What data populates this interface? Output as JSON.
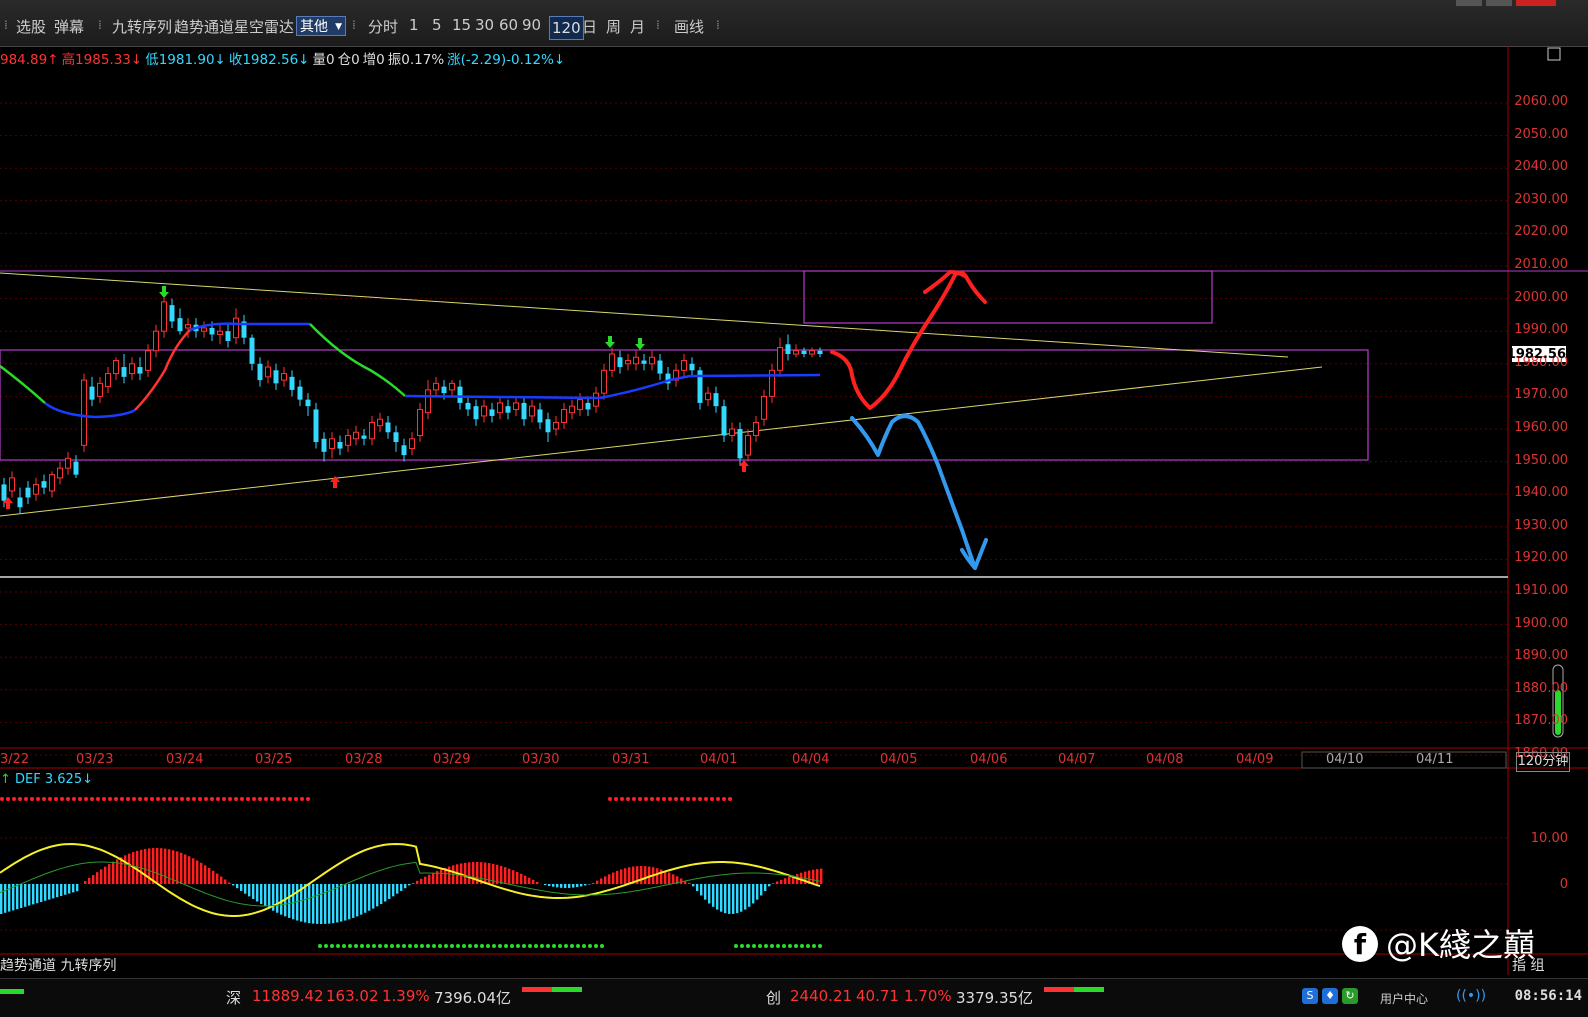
{
  "toolbar": {
    "items": [
      "选股",
      "弹幕",
      "九转序列",
      "趋势通道",
      "星空雷达"
    ],
    "dropdown_value": "其他",
    "periods": [
      "分时",
      "1",
      "5",
      "15",
      "30",
      "60",
      "90"
    ],
    "active_period": "120",
    "periods_after": [
      "日",
      "周",
      "月"
    ],
    "draw": "画线"
  },
  "info_line": {
    "open": "984.89↑",
    "high": "高1985.33↓",
    "low": "低1981.90↓",
    "close": "收1982.56↓",
    "volume": "量0",
    "position": "仓0",
    "increase": "增0",
    "amplitude": "振0.17%",
    "change": "涨(-2.29)-0.12%↓"
  },
  "price_axis": [
    "2060.00",
    "2050.00",
    "2040.00",
    "2030.00",
    "2020.00",
    "2010.00",
    "2000.00",
    "1990.00",
    "1980.00",
    "1970.00",
    "1960.00",
    "1950.00",
    "1940.00",
    "1930.00",
    "1920.00",
    "1910.00",
    "1900.00",
    "1890.00",
    "1880.00",
    "1870.00",
    "1860.00"
  ],
  "current_price": "1982.56",
  "date_axis": [
    "3/22",
    "03/23",
    "03/24",
    "03/25",
    "03/28",
    "03/29",
    "03/30",
    "03/31",
    "04/01",
    "04/04",
    "04/05",
    "04/06",
    "04/07",
    "04/08",
    "04/09",
    "04/10",
    "04/11"
  ],
  "period_label": "120分钟",
  "indicator": {
    "arrow": "↑",
    "label": "DEF 3.625↓"
  },
  "sub_axis": [
    "10.00",
    "0"
  ],
  "bottom_tabs": [
    "趋势通道",
    "九转序列"
  ],
  "status_bar": {
    "sz_label": "深",
    "sz_value": "11889.42",
    "sz_change": "163.02",
    "sz_pct": "1.39%",
    "sz_amount": "7396.04亿",
    "cy_label": "创",
    "cy_value": "2440.21",
    "cy_change": "40.71",
    "cy_pct": "1.70%",
    "cy_amount": "3379.35亿",
    "user_center": "用户中心",
    "time": "08:56:14"
  },
  "watermark": "@K綫之巔",
  "side_tab": "指 组",
  "colors": {
    "up": "#ff3333",
    "down": "#33d9ff",
    "ma_blue": "#1a3cff",
    "trend_line": "#d8d86a",
    "box": "#b43cc8",
    "annot_red": "#ff2020",
    "annot_blue": "#3399ee"
  }
}
